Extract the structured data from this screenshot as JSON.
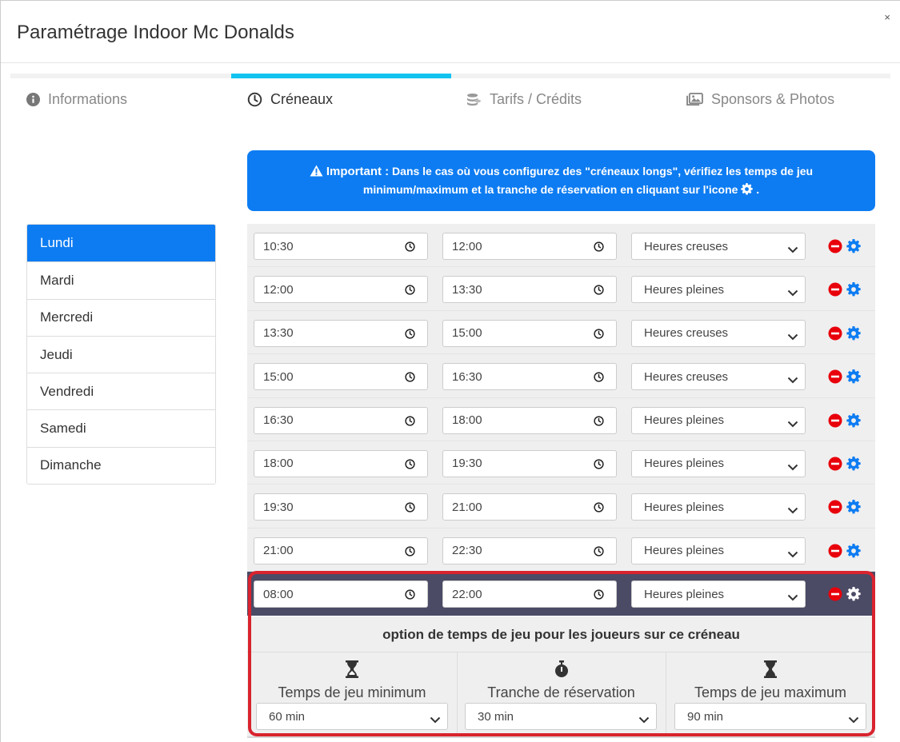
{
  "modal": {
    "title": "Paramétrage Indoor Mc Donalds",
    "close": "×"
  },
  "tabs": [
    {
      "label": "Informations",
      "icon": "info-circle-icon",
      "active": false
    },
    {
      "label": "Créneaux",
      "icon": "clock-icon",
      "active": true
    },
    {
      "label": "Tarifs / Crédits",
      "icon": "coins-icon",
      "active": false
    },
    {
      "label": "Sponsors & Photos",
      "icon": "images-icon",
      "active": false
    }
  ],
  "colors": {
    "accent": "#0d7cf2",
    "tab_active_bar": "#12c3f0",
    "highlight_row": "#4b4b66",
    "highlight_frame": "#d9232e",
    "remove": "#e8000b"
  },
  "alert": {
    "strong": "Important :",
    "line1": " Dans le cas où vous configurez des \"créneaux longs\", vérifiez les temps de jeu",
    "line2": "minimum/maximum et la tranche de réservation en cliquant sur l'icone",
    "line2_end": " ."
  },
  "days": [
    "Lundi",
    "Mardi",
    "Mercredi",
    "Jeudi",
    "Vendredi",
    "Samedi",
    "Dimanche"
  ],
  "slots": [
    {
      "start": "10:30",
      "end": "12:00",
      "type": "Heures creuses"
    },
    {
      "start": "12:00",
      "end": "13:30",
      "type": "Heures pleines"
    },
    {
      "start": "13:30",
      "end": "15:00",
      "type": "Heures creuses"
    },
    {
      "start": "15:00",
      "end": "16:30",
      "type": "Heures creuses"
    },
    {
      "start": "16:30",
      "end": "18:00",
      "type": "Heures pleines"
    },
    {
      "start": "18:00",
      "end": "19:30",
      "type": "Heures pleines"
    },
    {
      "start": "19:30",
      "end": "21:00",
      "type": "Heures pleines"
    },
    {
      "start": "21:00",
      "end": "22:30",
      "type": "Heures pleines"
    },
    {
      "start": "08:00",
      "end": "22:00",
      "type": "Heures pleines"
    }
  ],
  "options": {
    "title": "option de temps de jeu pour les joueurs sur ce créneau",
    "min": {
      "label": "Temps de jeu minimum",
      "value": "60 min"
    },
    "slice": {
      "label": "Tranche de réservation",
      "value": "30 min"
    },
    "max": {
      "label": "Temps de jeu maximum",
      "value": "90 min"
    }
  }
}
